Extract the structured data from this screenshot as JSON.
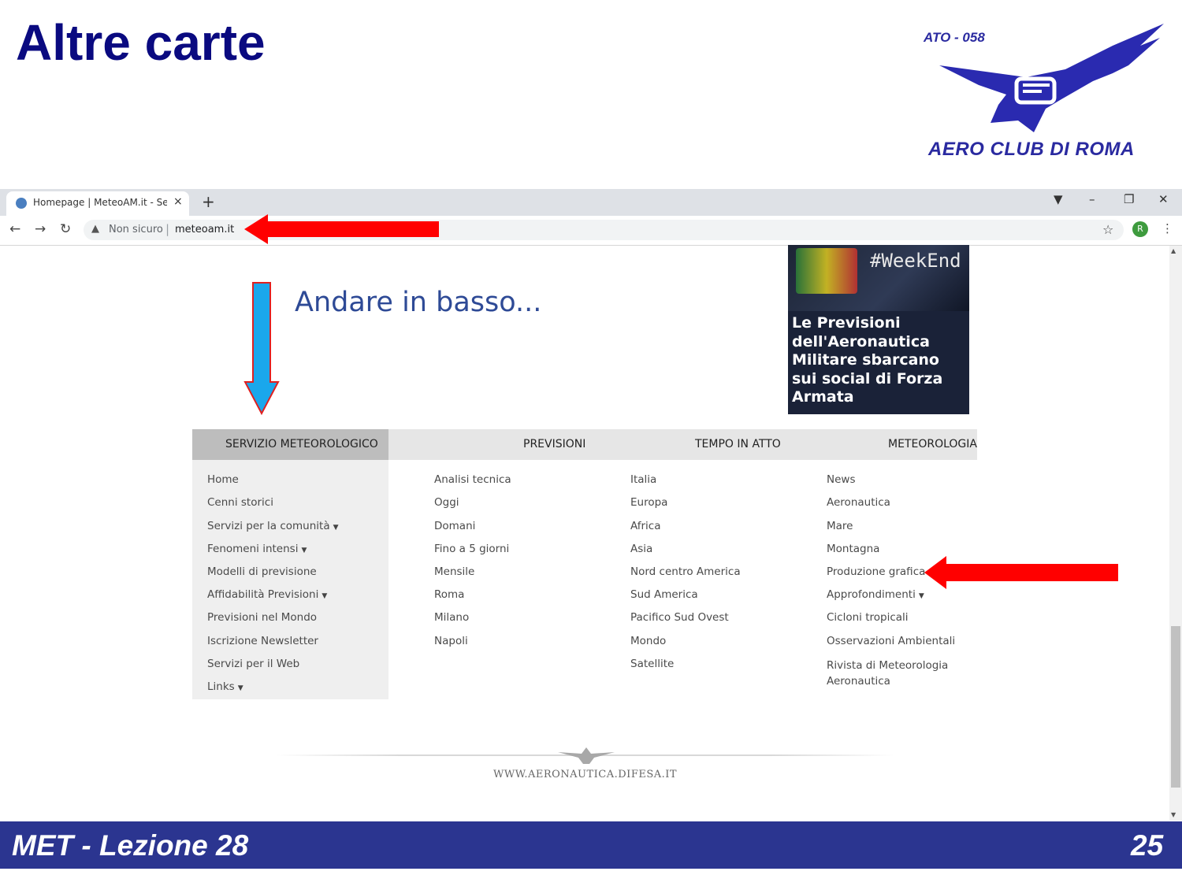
{
  "slide": {
    "title": "Altre carte",
    "footer_lesson": "MET - Lezione 28",
    "page_number": "25"
  },
  "logo": {
    "code": "ATO - 058",
    "name": "AERO CLUB DI ROMA"
  },
  "browser": {
    "tab_title": "Homepage | MeteoAM.it - Servizi",
    "tab_close": "×",
    "new_tab": "+",
    "security_label": "Non sicuro",
    "url": "meteoam.it",
    "profile_initial": "R"
  },
  "annotation": {
    "scroll_hint": "Andare in basso..."
  },
  "news_card": {
    "tag": "#WeekEnd",
    "headline": "Le Previsioni dell'Aeronautica Militare sbarcano sui social di Forza Armata"
  },
  "menu": {
    "columns": [
      {
        "header": "SERVIZIO METEOROLOGICO",
        "items": [
          {
            "label": "Home",
            "dropdown": false
          },
          {
            "label": "Cenni storici",
            "dropdown": false
          },
          {
            "label": "Servizi per la comunità",
            "dropdown": true
          },
          {
            "label": "Fenomeni intensi",
            "dropdown": true
          },
          {
            "label": "Modelli di previsione",
            "dropdown": false
          },
          {
            "label": "Affidabilità Previsioni",
            "dropdown": true
          },
          {
            "label": "Previsioni nel Mondo",
            "dropdown": false
          },
          {
            "label": "Iscrizione Newsletter",
            "dropdown": false
          },
          {
            "label": "Servizi per il Web",
            "dropdown": false
          },
          {
            "label": "Links",
            "dropdown": true
          }
        ]
      },
      {
        "header": "PREVISIONI",
        "items": [
          {
            "label": "Analisi tecnica",
            "dropdown": false
          },
          {
            "label": "Oggi",
            "dropdown": false
          },
          {
            "label": "Domani",
            "dropdown": false
          },
          {
            "label": "Fino a 5 giorni",
            "dropdown": false
          },
          {
            "label": "Mensile",
            "dropdown": false
          },
          {
            "label": "Roma",
            "dropdown": false
          },
          {
            "label": "Milano",
            "dropdown": false
          },
          {
            "label": "Napoli",
            "dropdown": false
          }
        ]
      },
      {
        "header": "TEMPO IN ATTO",
        "items": [
          {
            "label": "Italia",
            "dropdown": false
          },
          {
            "label": "Europa",
            "dropdown": false
          },
          {
            "label": "Africa",
            "dropdown": false
          },
          {
            "label": "Asia",
            "dropdown": false
          },
          {
            "label": "Nord centro America",
            "dropdown": false
          },
          {
            "label": "Sud America",
            "dropdown": false
          },
          {
            "label": "Pacifico Sud Ovest",
            "dropdown": false
          },
          {
            "label": "Mondo",
            "dropdown": false
          },
          {
            "label": "Satellite",
            "dropdown": false
          }
        ]
      },
      {
        "header": "METEOROLOGIA",
        "items": [
          {
            "label": "News",
            "dropdown": false
          },
          {
            "label": "Aeronautica",
            "dropdown": false
          },
          {
            "label": "Mare",
            "dropdown": false
          },
          {
            "label": "Montagna",
            "dropdown": false
          },
          {
            "label": "Produzione grafica",
            "dropdown": false
          },
          {
            "label": "Approfondimenti",
            "dropdown": true
          },
          {
            "label": "Cicloni tropicali",
            "dropdown": false
          },
          {
            "label": "Osservazioni Ambientali",
            "dropdown": false
          },
          {
            "label": "Rivista di Meteorologia Aeronautica",
            "dropdown": false
          }
        ]
      }
    ]
  },
  "site_footer": {
    "url_text": "WWW.AERONAUTICA.DIFESA.IT"
  },
  "colors": {
    "slide_title": "#0a0a80",
    "footer_bar": "#2b3590",
    "annotation_arrow_red": "#ff0000",
    "annotation_arrow_blue": "#1aa7ec"
  }
}
